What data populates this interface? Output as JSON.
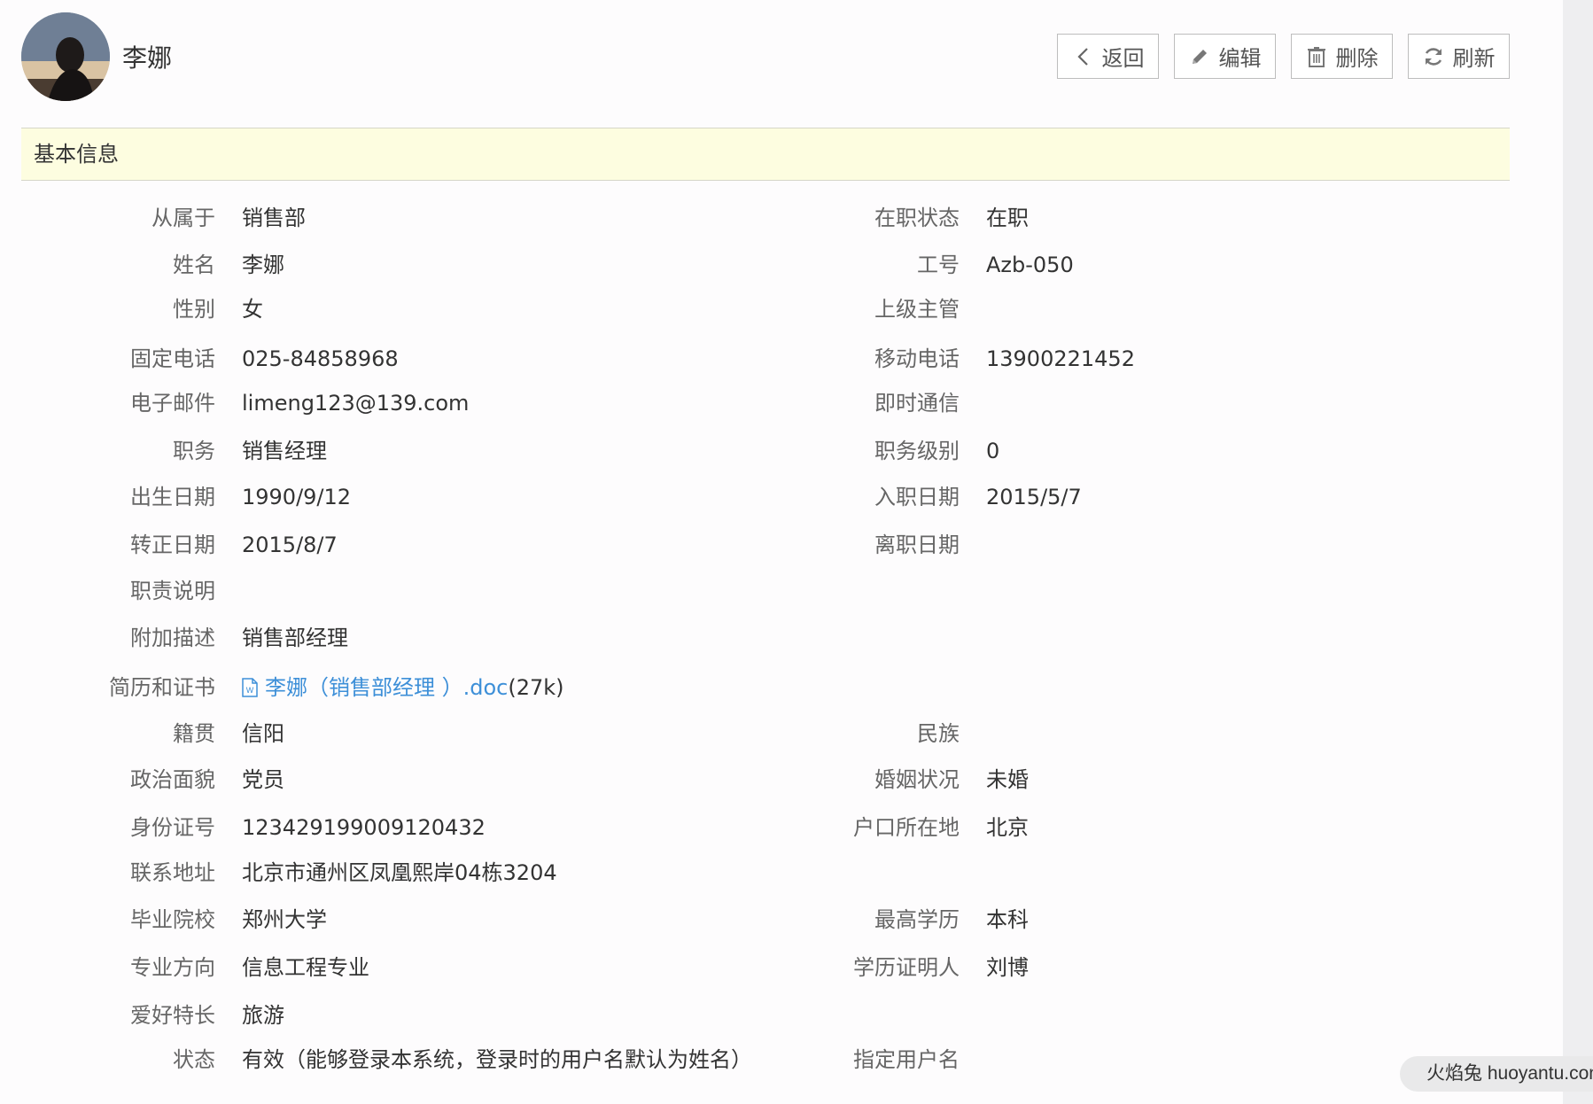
{
  "header": {
    "name": "李娜",
    "buttons": {
      "back": "返回",
      "edit": "编辑",
      "delete": "删除",
      "refresh": "刷新"
    }
  },
  "section_title": "基本信息",
  "fields": {
    "department": {
      "label": "从属于",
      "value": "销售部"
    },
    "employment_status": {
      "label": "在职状态",
      "value": "在职"
    },
    "name": {
      "label": "姓名",
      "value": "李娜"
    },
    "employee_id": {
      "label": "工号",
      "value": "Azb-050"
    },
    "gender": {
      "label": "性别",
      "value": "女"
    },
    "supervisor": {
      "label": "上级主管",
      "value": ""
    },
    "landline": {
      "label": "固定电话",
      "value": "025-84858968"
    },
    "mobile": {
      "label": "移动电话",
      "value": "13900221452"
    },
    "email": {
      "label": "电子邮件",
      "value": "limeng123@139.com"
    },
    "im": {
      "label": "即时通信",
      "value": ""
    },
    "position": {
      "label": "职务",
      "value": "销售经理"
    },
    "position_level": {
      "label": "职务级别",
      "value": "0"
    },
    "birth_date": {
      "label": "出生日期",
      "value": "1990/9/12"
    },
    "hire_date": {
      "label": "入职日期",
      "value": "2015/5/7"
    },
    "regularization_date": {
      "label": "转正日期",
      "value": "2015/8/7"
    },
    "leave_date": {
      "label": "离职日期",
      "value": ""
    },
    "duties": {
      "label": "职责说明",
      "value": ""
    },
    "extra_desc": {
      "label": "附加描述",
      "value": "销售部经理"
    },
    "resume": {
      "label": "简历和证书",
      "file_name": "李娜（销售部经理 ）.doc",
      "file_size": "(27k)"
    },
    "native_place": {
      "label": "籍贯",
      "value": "信阳"
    },
    "ethnicity": {
      "label": "民族",
      "value": ""
    },
    "political_status": {
      "label": "政治面貌",
      "value": "党员"
    },
    "marital_status": {
      "label": "婚姻状况",
      "value": "未婚"
    },
    "id_number": {
      "label": "身份证号",
      "value": "123429199009120432"
    },
    "hukou": {
      "label": "户口所在地",
      "value": "北京"
    },
    "address": {
      "label": "联系地址",
      "value": "北京市通州区凤凰熙岸04栋3204"
    },
    "school": {
      "label": "毕业院校",
      "value": "郑州大学"
    },
    "education": {
      "label": "最高学历",
      "value": "本科"
    },
    "major": {
      "label": "专业方向",
      "value": "信息工程专业"
    },
    "education_witness": {
      "label": "学历证明人",
      "value": "刘博"
    },
    "hobbies": {
      "label": "爱好特长",
      "value": "旅游"
    },
    "status": {
      "label": "状态",
      "value": "有效（能够登录本系统，登录时的用户名默认为姓名）"
    },
    "username": {
      "label": "指定用户名",
      "value": ""
    }
  },
  "watermark": "火焰兔 huoyantu.com"
}
